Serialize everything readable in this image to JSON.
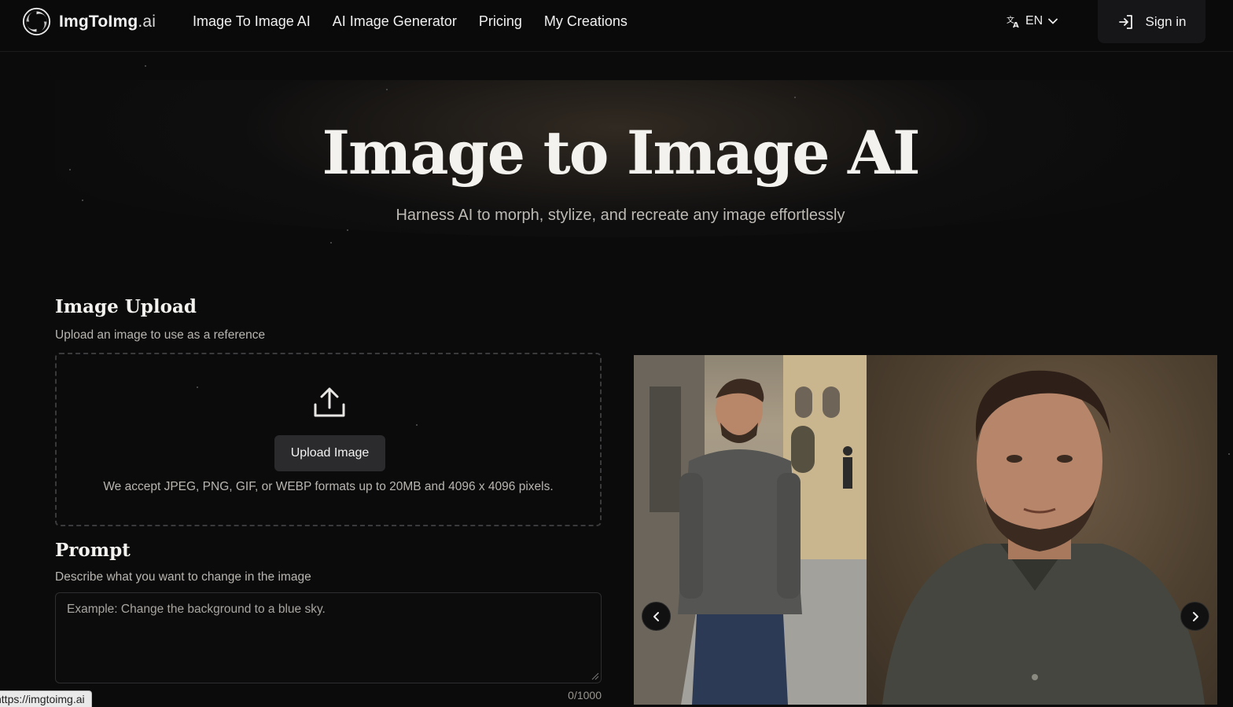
{
  "nav": {
    "logo_main": "ImgToImg",
    "logo_ext": ".ai",
    "links": [
      "Image To Image AI",
      "AI Image Generator",
      "Pricing",
      "My Creations"
    ],
    "language": "EN",
    "signin_label": "Sign in"
  },
  "hero": {
    "title": "Image to Image AI",
    "subtitle": "Harness AI to morph, stylize, and recreate any image effortlessly"
  },
  "upload": {
    "title": "Image Upload",
    "description": "Upload an image to use as a reference",
    "button_label": "Upload Image",
    "note": "We accept JPEG, PNG, GIF, or WEBP formats up to 20MB and 4096 x 4096 pixels."
  },
  "prompt": {
    "title": "Prompt",
    "description": "Describe what you want to change in the image",
    "placeholder": "Example: Change the background to a blue sky.",
    "value": "",
    "counter": "0/1000"
  },
  "status_bar": {
    "url": "https://imgtoimg.ai"
  },
  "colors": {
    "background": "#0b0b0c",
    "text": "#e8e6e3",
    "muted": "#b9b6b0",
    "button": "#2b2b2d"
  }
}
